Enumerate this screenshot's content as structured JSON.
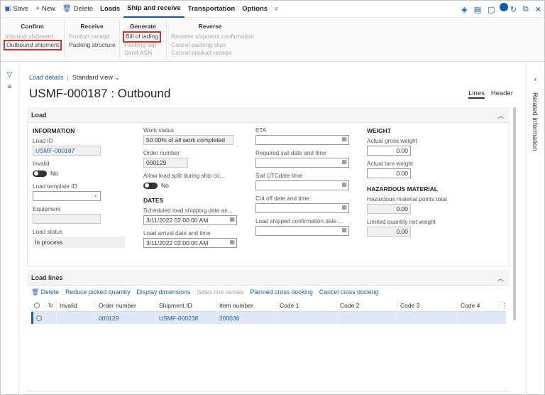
{
  "actionbar": {
    "save": "Save",
    "new": "New",
    "delete": "Delete",
    "tabs": [
      "Loads",
      "Ship and receive",
      "Transportation",
      "Options"
    ],
    "notification_count": "0"
  },
  "ribbon": {
    "confirm": {
      "title": "Confirm",
      "items": [
        "Inbound shipment",
        "Outbound shipment"
      ]
    },
    "receive": {
      "title": "Receive",
      "items": [
        "Product receipt",
        "Packing structure"
      ]
    },
    "generate": {
      "title": "Generate",
      "items": [
        "Bill of lading",
        "Packing slip",
        "Send ASN"
      ]
    },
    "reverse": {
      "title": "Reverse",
      "items": [
        "Reverse shipment confirmation",
        "Cancel packing slips",
        "Cancel product receipt"
      ]
    }
  },
  "header": {
    "breadcrumb": "Load details",
    "view": "Standard view",
    "title": "USMF-000187 : Outbound",
    "tabs": [
      "Lines",
      "Header"
    ]
  },
  "rightpane": {
    "label": "Related information"
  },
  "load": {
    "section_title": "Load",
    "information": {
      "group": "INFORMATION",
      "load_id_label": "Load ID",
      "load_id": "USMF-000187",
      "invalid_label": "Invalid",
      "invalid_value": "No",
      "template_label": "Load template ID",
      "equipment_label": "Equipment",
      "status_label": "Load status",
      "status_value": "In process"
    },
    "work": {
      "work_status_label": "Work status",
      "work_status": "50.00% of all work completed",
      "order_label": "Order number",
      "order": "000129",
      "split_label": "Allow load split during ship co...",
      "split_value": "No"
    },
    "dates": {
      "group": "DATES",
      "sched_label": "Scheduled load shipping date an...",
      "sched_value": "3/11/2022 02:00:00 AM",
      "arrival_label": "Load arrival date and time",
      "arrival_value": "3/11/2022 02:00:00 AM"
    },
    "eta": {
      "eta_label": "ETA",
      "req_sail_label": "Required sail date and time",
      "sail_utc_label": "Sail UTCdate time",
      "cutoff_label": "Cut off date and time",
      "shipped_conf_label": "Load shipped confirmation date ..."
    },
    "weight": {
      "group": "WEIGHT",
      "gross_label": "Actual gross weight",
      "gross_value": "0.00",
      "tare_label": "Actual tare weight",
      "tare_value": "0.00"
    },
    "hazard": {
      "group": "HAZARDOUS MATERIAL",
      "points_label": "Hazardous material points total",
      "points_value": "0.00",
      "limited_label": "Limited quantity net weight",
      "limited_value": "0.00"
    }
  },
  "load_lines": {
    "section_title": "Load lines",
    "toolbar": [
      "Delete",
      "Reduce picked quantity",
      "Display dimensions",
      "Sales line serials",
      "Planned cross docking",
      "Cancel cross docking"
    ],
    "columns": [
      "Invalid",
      "Order number",
      "Shipment ID",
      "Item number",
      "Code 1",
      "Code 2",
      "Code 3",
      "Code 4"
    ],
    "rows": [
      {
        "invalid": "",
        "order": "000129",
        "shipment": "USMF-000238",
        "item": "200036",
        "code1": "",
        "code2": "",
        "code3": "",
        "code4": ""
      }
    ]
  }
}
